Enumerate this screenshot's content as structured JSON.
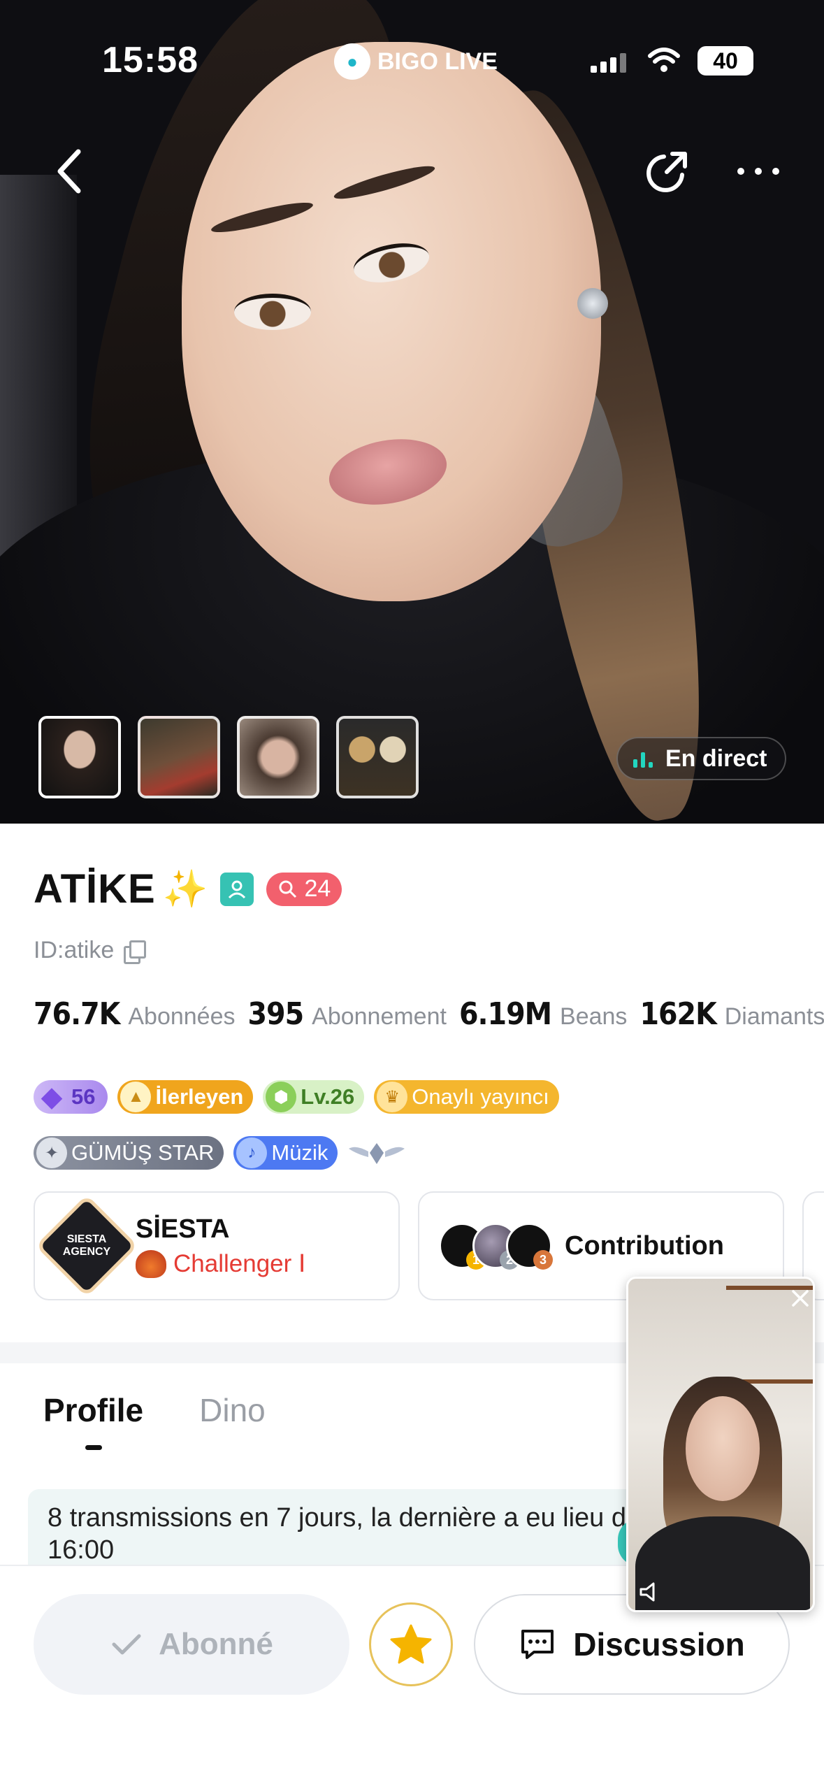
{
  "status_bar": {
    "time": "15:58",
    "brand": "BIGO LIVE",
    "battery": "40"
  },
  "gallery": {
    "thumbnails": [
      "photo-1",
      "photo-2",
      "photo-3",
      "photo-4"
    ],
    "live_label": "En direct"
  },
  "profile": {
    "name": "ATİKE",
    "sparkle": "✨",
    "level_badge": "24",
    "id": "ID:atike",
    "stats": [
      {
        "value": "76.7K",
        "label": "Abonnées"
      },
      {
        "value": "395",
        "label": "Abonnement"
      },
      {
        "value": "6.19M",
        "label": "Beans"
      },
      {
        "value": "162K",
        "label": "Diamants"
      }
    ],
    "badges_row1": [
      "56",
      "İlerleyen",
      "Lv.26",
      "Onaylı yayıncı"
    ],
    "badges_row2": [
      "GÜMÜŞ STAR",
      "Müzik"
    ]
  },
  "agency_card": {
    "logo_text": "SIESTA AGENCY",
    "name": "SİESTA",
    "rank": "Challenger Ⅰ"
  },
  "contribution_card": {
    "label": "Contribution",
    "ranks": [
      "1",
      "2",
      "3"
    ]
  },
  "tabs": [
    {
      "label": "Profile",
      "active": true
    },
    {
      "label": "Dino",
      "active": false
    }
  ],
  "notice": {
    "text": "8 transmissions en 7 jours, la dernière a eu lieu de 15:00 - 16:00"
  },
  "actions": {
    "subscribed": "Abonné",
    "chat": "Discussion"
  },
  "colors": {
    "accent_teal": "#22d6c0",
    "level_pink": "#f2606d",
    "agency_red": "#e53b34",
    "star_gold": "#f5b400"
  }
}
